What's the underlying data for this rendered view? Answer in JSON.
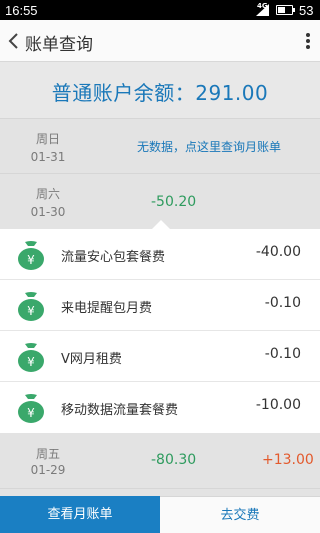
{
  "status_bar": {
    "time": "16:55",
    "network": "4G",
    "battery_percent": "53",
    "battery_level": 0.53
  },
  "header": {
    "title": "账单查询"
  },
  "balance": {
    "label": "普通账户余额：291.00"
  },
  "days": [
    {
      "weekday": "周日",
      "date": "01-31",
      "no_data_text": "无数据，点这里查询月账单"
    },
    {
      "weekday": "周六",
      "date": "01-30",
      "expense": "-50.20"
    },
    {
      "weekday": "周五",
      "date": "01-29",
      "expense": "-80.30",
      "income": "+13.00"
    }
  ],
  "details": [
    {
      "name": "流量安心包套餐费",
      "amount": "-40.00",
      "icon": "money-bag-icon"
    },
    {
      "name": "来电提醒包月费",
      "amount": "-0.10",
      "icon": "money-bag-icon"
    },
    {
      "name": "V网月租费",
      "amount": "-0.10",
      "icon": "money-bag-icon"
    },
    {
      "name": "移动数据流量套餐费",
      "amount": "-10.00",
      "icon": "money-bag-icon"
    }
  ],
  "bottom": {
    "monthly_bill": "查看月账单",
    "pay": "去交费"
  },
  "colors": {
    "accent_blue": "#1a78b9",
    "expense_green": "#2e9b5e",
    "income_red": "#e35a2d",
    "icon_green": "#3aa86b"
  }
}
